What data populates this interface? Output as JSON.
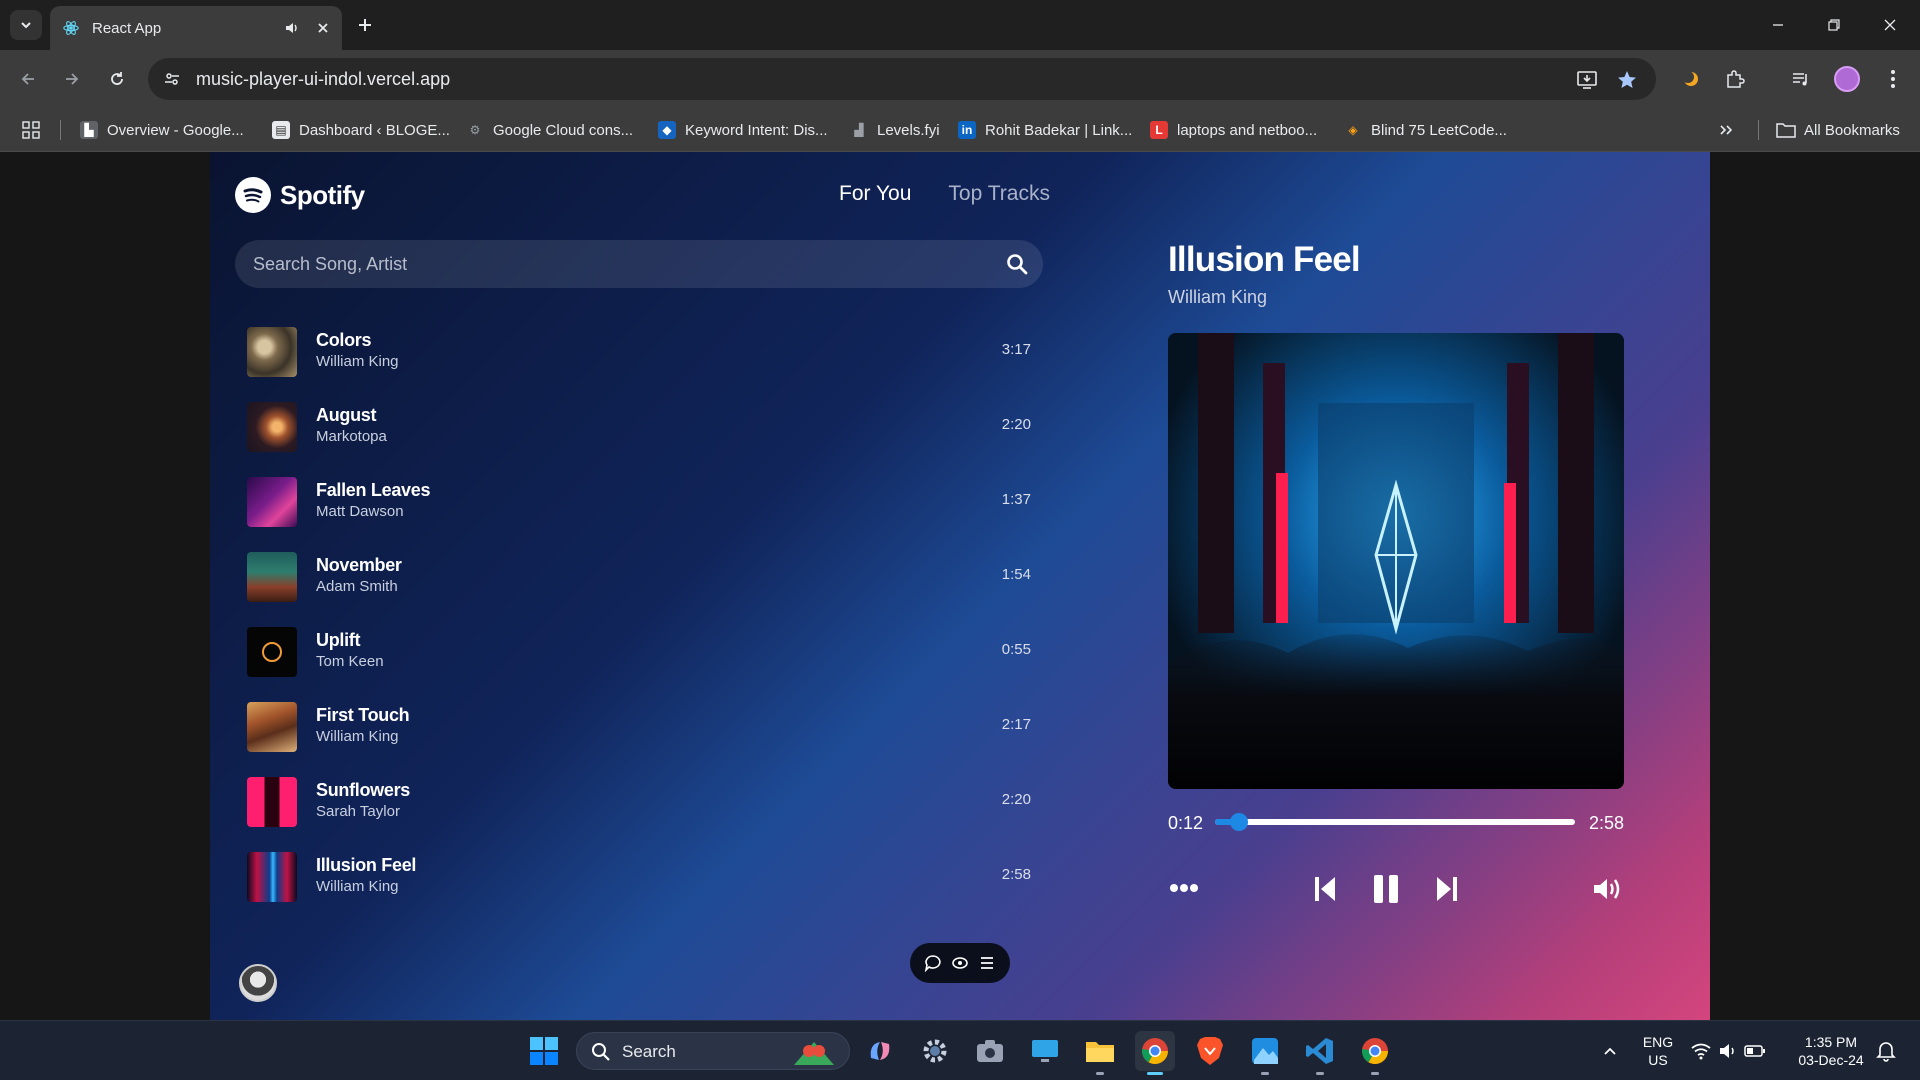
{
  "browser": {
    "tab_title": "React App",
    "url": "music-player-ui-indol.vercel.app",
    "bookmarks": [
      {
        "label": "Overview - Google..."
      },
      {
        "label": "Dashboard ‹ BLOGE..."
      },
      {
        "label": "Google Cloud cons..."
      },
      {
        "label": "Keyword Intent: Dis..."
      },
      {
        "label": "Levels.fyi"
      },
      {
        "label": "Rohit Badekar | Link..."
      },
      {
        "label": "laptops and netboo..."
      },
      {
        "label": "Blind 75 LeetCode..."
      }
    ],
    "all_bookmarks": "All Bookmarks"
  },
  "app": {
    "logo_text": "Spotify",
    "nav": {
      "for_you": "For You",
      "top_tracks": "Top Tracks"
    },
    "search_placeholder": "Search Song, Artist",
    "tracks": [
      {
        "name": "Colors",
        "artist": "William King",
        "duration": "3:17"
      },
      {
        "name": "August",
        "artist": "Markotopa",
        "duration": "2:20"
      },
      {
        "name": "Fallen Leaves",
        "artist": "Matt Dawson",
        "duration": "1:37"
      },
      {
        "name": "November",
        "artist": "Adam Smith",
        "duration": "1:54"
      },
      {
        "name": "Uplift",
        "artist": "Tom Keen",
        "duration": "0:55"
      },
      {
        "name": "First Touch",
        "artist": "William King",
        "duration": "2:17"
      },
      {
        "name": "Sunflowers",
        "artist": "Sarah Taylor",
        "duration": "2:20"
      },
      {
        "name": "Illusion Feel",
        "artist": "William King",
        "duration": "2:58"
      }
    ],
    "player": {
      "title": "Illusion Feel",
      "artist": "William King",
      "current_time": "0:12",
      "total_time": "2:58",
      "progress_fraction": 0.067
    }
  },
  "taskbar": {
    "search_label": "Search",
    "language": "ENG",
    "region": "US",
    "time": "1:35 PM",
    "date": "03-Dec-24"
  },
  "colors": {
    "accent": "#1e88e5",
    "gradient_start": "#0a1431",
    "gradient_end": "#d4457d"
  }
}
